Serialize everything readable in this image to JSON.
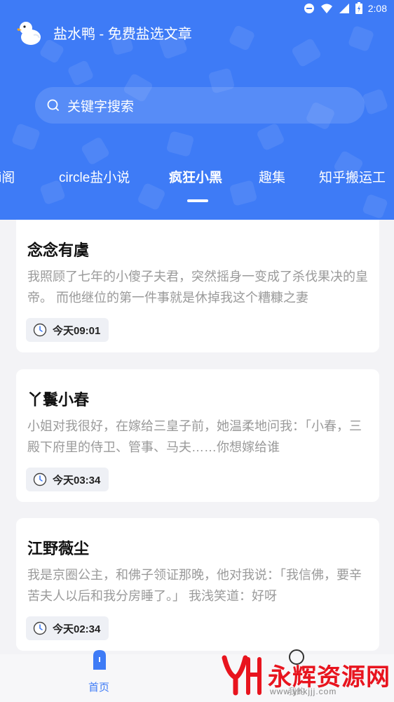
{
  "status_bar": {
    "time": "2:08"
  },
  "app": {
    "title": "盐水鸭 - 免费盐选文章"
  },
  "search": {
    "placeholder": "关键字搜索"
  },
  "tabs": [
    {
      "label": "i阁",
      "active": false
    },
    {
      "label": "circle盐小说",
      "active": false
    },
    {
      "label": "疯狂小黑",
      "active": true
    },
    {
      "label": "趣集",
      "active": false
    },
    {
      "label": "知乎搬运工",
      "active": false
    }
  ],
  "cards": [
    {
      "title": "念念有虞",
      "excerpt": "我照顾了七年的小傻子夫君，突然摇身一变成了杀伐果决的皇帝。 而他继位的第一件事就是休掉我这个糟糠之妻",
      "time": "今天09:01"
    },
    {
      "title": "丫鬟小春",
      "excerpt": "小姐对我很好，在嫁给三皇子前，她温柔地问我：「小春，三殿下府里的侍卫、管事、马夫……你想嫁给谁",
      "time": "今天03:34"
    },
    {
      "title": "江野薇尘",
      "excerpt": "我是京圈公主，和佛子领证那晚，他对我说：「我信佛，要辛苦夫人以后和我分房睡了。」 我浅笑道：好呀",
      "time": "今天02:34"
    }
  ],
  "bottom_nav": [
    {
      "label": "首页",
      "active": true,
      "icon": "home-icon"
    },
    {
      "label": "我的",
      "active": false,
      "icon": "profile-icon"
    }
  ],
  "watermark": {
    "text": "永辉资源网",
    "url": "www.yhkjjj.com"
  },
  "colors": {
    "accent": "#3e7bf6",
    "watermark": "#e8141e"
  }
}
